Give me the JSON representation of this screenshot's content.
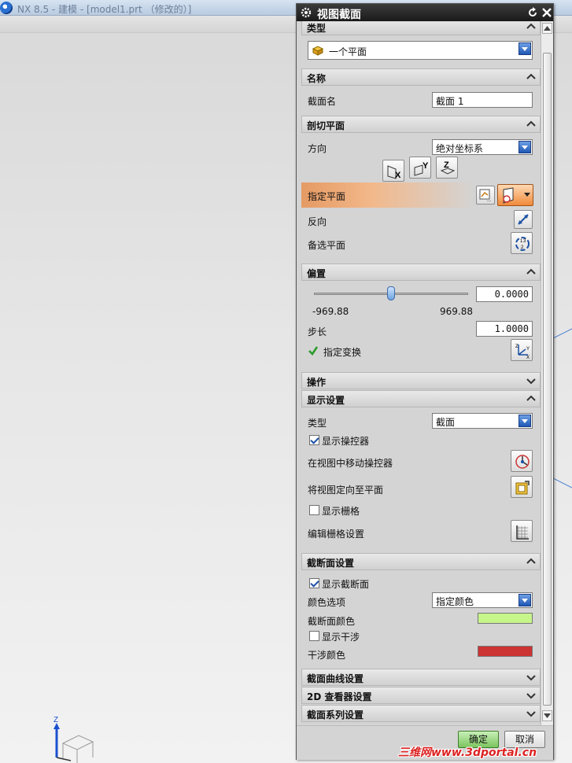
{
  "app": {
    "title": "NX 8.5 - 建模 - [model1.prt （修改的）]"
  },
  "dialog": {
    "title": "视图截面",
    "sections": {
      "type": {
        "header": "类型",
        "value": "一个平面"
      },
      "name": {
        "header": "名称",
        "label": "截面名",
        "value": "截面 1"
      },
      "cut_plane": {
        "header": "剖切平面",
        "direction_label": "方向",
        "direction_value": "绝对坐标系",
        "axis_buttons": [
          "X",
          "Y",
          "Z"
        ],
        "specify_plane_label": "指定平面",
        "reverse_label": "反向",
        "alternate_plane_label": "备选平面"
      },
      "offset": {
        "header": "偏置",
        "value": "0.0000",
        "min_label": "-969.88",
        "max_label": "969.88",
        "step_label": "步长",
        "step_value": "1.0000",
        "transform_label": "指定变换",
        "slider_position": 0.5
      },
      "operation": {
        "header": "操作"
      },
      "display": {
        "header": "显示设置",
        "type_label": "类型",
        "type_value": "截面",
        "show_manipulator_label": "显示操控器",
        "show_manipulator": true,
        "move_manipulator_label": "在视图中移动操控器",
        "orient_view_label": "将视图定向至平面",
        "show_grid_label": "显示栅格",
        "show_grid": false,
        "edit_grid_label": "编辑栅格设置"
      },
      "section_settings": {
        "header": "截断面设置",
        "show_section_label": "显示截断面",
        "show_section": true,
        "color_option_label": "颜色选项",
        "color_option_value": "指定颜色",
        "section_color_label": "截断面颜色",
        "section_color": "#c6f58a",
        "show_interference_label": "显示干涉",
        "show_interference": false,
        "interference_color_label": "干涉颜色",
        "interference_color": "#cc3333"
      },
      "curve_settings": {
        "header": "截面曲线设置"
      },
      "viewer_2d": {
        "header": "2D 查看器设置"
      },
      "series": {
        "header": "截面系列设置"
      }
    },
    "buttons": {
      "ok": "确定",
      "cancel": "取消"
    }
  },
  "watermark": "三维网www.3dportal.cn"
}
